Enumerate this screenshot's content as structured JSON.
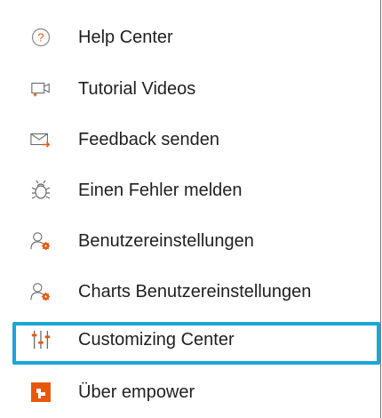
{
  "menu": {
    "items": [
      {
        "label": "Help Center",
        "icon": "help-circle-icon"
      },
      {
        "label": "Tutorial Videos",
        "icon": "video-camera-icon"
      },
      {
        "label": "Feedback senden",
        "icon": "envelope-arrow-icon"
      },
      {
        "label": "Einen Fehler melden",
        "icon": "bug-icon"
      },
      {
        "label": "Benutzereinstellungen",
        "icon": "user-settings-icon"
      },
      {
        "label": "Charts Benutzereinstellungen",
        "icon": "user-settings-icon"
      },
      {
        "label": "Customizing Center",
        "icon": "sliders-icon",
        "highlighted": true
      },
      {
        "label": "Über empower",
        "icon": "empower-logo-icon"
      }
    ]
  },
  "colors": {
    "accent_orange": "#e8580c",
    "highlight_border": "#1aa6d8",
    "icon_gray": "#5f5f5f",
    "text": "#1f1f1f"
  }
}
